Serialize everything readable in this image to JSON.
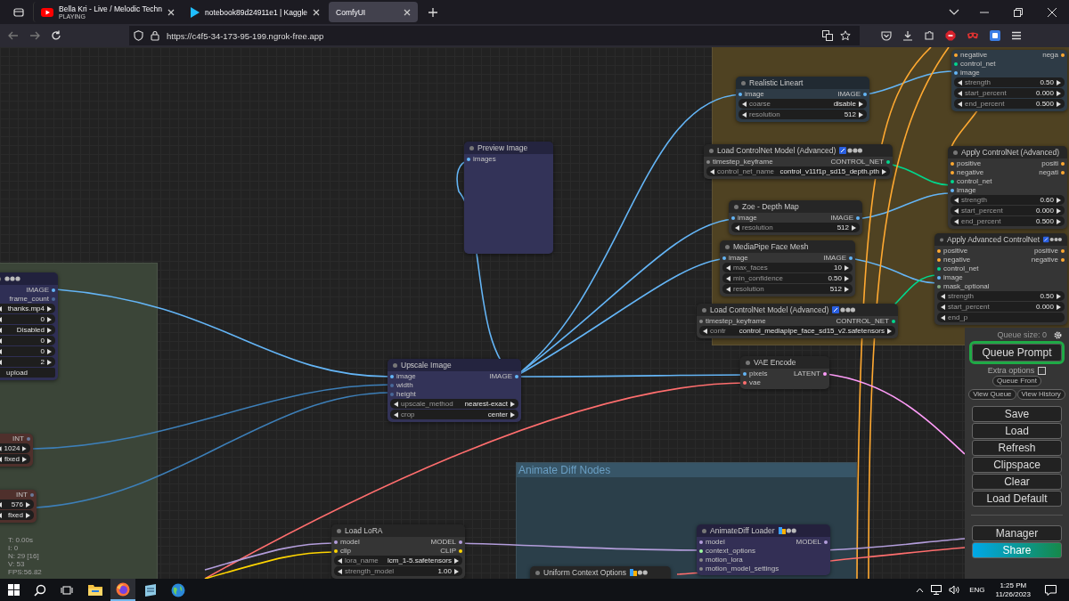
{
  "browser": {
    "tabs": [
      {
        "title": "Bella Kri - Live / Melodic Techn",
        "status": "PLAYING",
        "kind": "video",
        "selected": false
      },
      {
        "title": "notebook89d24911e1 | Kaggle",
        "kind": "kaggle",
        "selected": false
      },
      {
        "title": "ComfyUI",
        "kind": "plain",
        "selected": true
      }
    ],
    "url": "https://c4f5-34-173-95-199.ngrok-free.app"
  },
  "groups": [
    {
      "color": "#4f4222"
    },
    {
      "color": "#3b4538"
    },
    {
      "title": "Animate Diff Nodes",
      "color": "#2b3f4a"
    }
  ],
  "nodes": [
    {
      "kind": "dots",
      "color": "#2f2f55",
      "outputs": [
        {
          "label": "IMAGE",
          "color": "#64b5f6"
        },
        {
          "label": "frame_count",
          "color": "#4a6a9a"
        }
      ],
      "widgets": [
        {
          "value": "thanks.mp4"
        },
        {
          "value": "0"
        },
        {
          "value": "Disabled"
        },
        {
          "value": "0"
        },
        {
          "value": "0"
        },
        {
          "value": "2"
        },
        {
          "value": "upload",
          "kind": "button"
        }
      ]
    },
    {
      "kind": "plain",
      "color": "#4f302c",
      "outputs": [
        {
          "label": "INT",
          "color": "#6a7a9a"
        }
      ],
      "widgets": [
        {
          "value": "1024"
        },
        {
          "value": "fixed"
        }
      ]
    },
    {
      "kind": "plain",
      "color": "#4f302c",
      "outputs": [
        {
          "label": "INT",
          "color": "#6a7a9a"
        }
      ],
      "widgets": [
        {
          "value": "576"
        },
        {
          "value": "fixed"
        }
      ]
    },
    {
      "title": "Preview Image",
      "kind": "plain",
      "color": "#333358",
      "inputs": [
        {
          "label": "images",
          "color": "#64b5f6"
        }
      ]
    },
    {
      "title": "Upscale Image",
      "kind": "plain",
      "color": "#333358",
      "inputs": [
        {
          "label": "image",
          "color": "#64b5f6"
        },
        {
          "label": "width",
          "color": "#4a6a9a"
        },
        {
          "label": "height",
          "color": "#4a6a9a"
        }
      ],
      "outputs": [
        {
          "label": "IMAGE",
          "color": "#64b5f6"
        }
      ],
      "widgets": [
        {
          "name": "upscale_method",
          "value": "nearest-exact"
        },
        {
          "name": "crop",
          "value": "center"
        }
      ]
    },
    {
      "title": "Realistic Lineart",
      "kind": "plain",
      "color": "#2e3b46",
      "inputs": [
        {
          "label": "image",
          "color": "#64b5f6"
        }
      ],
      "outputs": [
        {
          "label": "IMAGE",
          "color": "#64b5f6"
        }
      ],
      "widgets": [
        {
          "name": "coarse",
          "value": "disable"
        },
        {
          "name": "resolution",
          "value": "512"
        }
      ]
    },
    {
      "title": "Load ControlNet Model (Advanced)",
      "kind": "cn",
      "color": "#353535",
      "inputs": [
        {
          "label": "timestep_keyframe",
          "color": "#888888"
        }
      ],
      "outputs": [
        {
          "label": "CONTROL_NET",
          "color": "#00d78d"
        }
      ],
      "widgets": [
        {
          "name": "control_net_name",
          "value": "control_v11f1p_sd15_depth.pth"
        }
      ]
    },
    {
      "title": "Zoe - Depth Map",
      "kind": "plain",
      "color": "#353535",
      "inputs": [
        {
          "label": "image",
          "color": "#64b5f6"
        }
      ],
      "outputs": [
        {
          "label": "IMAGE",
          "color": "#64b5f6"
        }
      ],
      "widgets": [
        {
          "name": "resolution",
          "value": "512"
        }
      ]
    },
    {
      "title": "MediaPipe Face Mesh",
      "kind": "plain",
      "color": "#353535",
      "inputs": [
        {
          "label": "image",
          "color": "#64b5f6"
        }
      ],
      "outputs": [
        {
          "label": "IMAGE",
          "color": "#64b5f6"
        }
      ],
      "widgets": [
        {
          "name": "max_faces",
          "value": "10"
        },
        {
          "name": "min_confidence",
          "value": "0.50"
        },
        {
          "name": "resolution",
          "value": "512"
        }
      ]
    },
    {
      "title": "Load ControlNet Model (Advanced)",
      "kind": "cn",
      "color": "#353535",
      "inputs": [
        {
          "label": "timestep_keyframe",
          "color": "#888888"
        }
      ],
      "outputs": [
        {
          "label": "CONTROL_NET",
          "color": "#00d78d"
        }
      ],
      "widgets": [
        {
          "name": "contr",
          "value": "control_mediapipe_face_sd15_v2.safetensors"
        }
      ]
    },
    {
      "kind": "plain",
      "color": "#2e3b46",
      "inputs": [
        {
          "label": "negative",
          "color": "#ffa931"
        },
        {
          "label": "control_net",
          "color": "#00d78d"
        },
        {
          "label": "image",
          "color": "#64b5f6"
        }
      ],
      "outputs": [
        {
          "label": "nega",
          "color": "#ffa931"
        }
      ],
      "widgets": [
        {
          "name": "strength",
          "value": "0.50"
        },
        {
          "name": "start_percent",
          "value": "0.000"
        },
        {
          "name": "end_percent",
          "value": "0.500"
        }
      ]
    },
    {
      "title": "Apply ControlNet (Advanced)",
      "kind": "plain",
      "color": "#353535",
      "inputs": [
        {
          "label": "positive",
          "color": "#ffa931"
        },
        {
          "label": "negative",
          "color": "#ffa931"
        },
        {
          "label": "control_net",
          "color": "#00d78d"
        },
        {
          "label": "image",
          "color": "#64b5f6"
        }
      ],
      "outputs": [
        {
          "label": "positi",
          "color": "#ffa931"
        },
        {
          "label": "negati",
          "color": "#ffa931"
        }
      ],
      "widgets": [
        {
          "name": "strength",
          "value": "0.60"
        },
        {
          "name": "start_percent",
          "value": "0.000"
        },
        {
          "name": "end_percent",
          "value": "0.500"
        }
      ]
    },
    {
      "title": "Apply Advanced ControlNet",
      "kind": "cn",
      "color": "#353535",
      "inputs": [
        {
          "label": "positive",
          "color": "#ffa931"
        },
        {
          "label": "negative",
          "color": "#ffa931"
        },
        {
          "label": "control_net",
          "color": "#00d78d"
        },
        {
          "label": "image",
          "color": "#64b5f6"
        },
        {
          "label": "mask_optional",
          "color": "#81a881"
        }
      ],
      "outputs": [
        {
          "label": "positive",
          "color": "#ffa931"
        },
        {
          "label": "negative",
          "color": "#ffa931"
        }
      ],
      "widgets": [
        {
          "name": "strength",
          "value": "0.50"
        },
        {
          "name": "start_percent",
          "value": "0.000"
        },
        {
          "name": "end_p"
        }
      ]
    },
    {
      "title": "VAE Encode",
      "kind": "plain",
      "color": "#353535",
      "inputs": [
        {
          "label": "pixels",
          "color": "#64b5f6"
        },
        {
          "label": "vae",
          "color": "#ff6e6e"
        }
      ],
      "outputs": [
        {
          "label": "LATENT",
          "color": "#ff9cf9"
        }
      ]
    },
    {
      "title": "Load LoRA",
      "kind": "plain",
      "color": "#353535",
      "inputs": [
        {
          "label": "model",
          "color": "#b39ddb"
        },
        {
          "label": "clip",
          "color": "#ffd500"
        }
      ],
      "outputs": [
        {
          "label": "MODEL",
          "color": "#b39ddb"
        },
        {
          "label": "CLIP",
          "color": "#ffd500"
        }
      ],
      "widgets": [
        {
          "name": "lora_name",
          "value": "lcm_1-5.safetensors"
        },
        {
          "name": "strength_model",
          "value": "1.00"
        }
      ]
    },
    {
      "title": "Uniform Context Options",
      "kind": "ad",
      "color": "#353535"
    },
    {
      "title": "AnimateDiff Loader",
      "kind": "ad",
      "color": "#332f55",
      "inputs": [
        {
          "label": "model",
          "color": "#b39ddb"
        },
        {
          "label": "context_options",
          "color": "#a0ffa0"
        },
        {
          "label": "motion_lora",
          "color": "#888888"
        },
        {
          "label": "motion_model_settings",
          "color": "#888888"
        }
      ],
      "outputs": [
        {
          "label": "MODEL",
          "color": "#b39ddb"
        }
      ]
    }
  ],
  "queue_panel": {
    "queue_size": "Queue size: 0",
    "queue_button": "Queue Prompt",
    "extra_options": {
      "label": "Extra options",
      "checked": false
    },
    "small_buttons": [
      "Queue Front",
      "View Queue",
      "View History"
    ],
    "buttons": [
      "Save",
      "Load",
      "Refresh",
      "Clipspace",
      "Clear",
      "Load Default"
    ],
    "bottom_buttons": [
      {
        "label": "Manager",
        "kind": "plain"
      },
      {
        "label": "Share",
        "kind": "gradient"
      }
    ]
  },
  "stats": [
    "T: 0.00s",
    "I: 0",
    "N: 29 [16]",
    "V: 53",
    "FPS:56.82"
  ],
  "taskbar": {
    "apps": [
      {
        "kind": "explorer",
        "selected": false
      },
      {
        "kind": "firefox",
        "selected": true
      },
      {
        "kind": "notes",
        "selected": false
      },
      {
        "kind": "globe",
        "selected": false
      }
    ],
    "language": "ENG",
    "time": "1:25 PM",
    "date": "11/26/2023"
  }
}
